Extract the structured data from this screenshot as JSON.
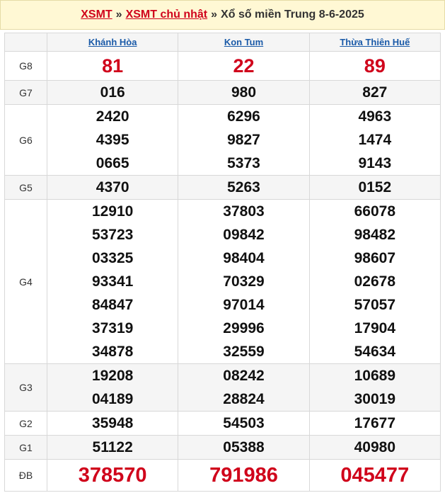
{
  "header": {
    "crumb1": "XSMT",
    "sep1": "»",
    "crumb2": "XSMT chủ nhật",
    "sep2": "»",
    "title": "Xổ số miền Trung 8-6-2025"
  },
  "columns": [
    "Khánh Hòa",
    "Kon Tum",
    "Thừa Thiên Huế"
  ],
  "prizes": [
    {
      "name": "G8",
      "values": [
        [
          "81"
        ],
        [
          "22"
        ],
        [
          "89"
        ]
      ]
    },
    {
      "name": "G7",
      "values": [
        [
          "016"
        ],
        [
          "980"
        ],
        [
          "827"
        ]
      ]
    },
    {
      "name": "G6",
      "values": [
        [
          "2420",
          "4395",
          "0665"
        ],
        [
          "6296",
          "9827",
          "5373"
        ],
        [
          "4963",
          "1474",
          "9143"
        ]
      ]
    },
    {
      "name": "G5",
      "values": [
        [
          "4370"
        ],
        [
          "5263"
        ],
        [
          "0152"
        ]
      ]
    },
    {
      "name": "G4",
      "values": [
        [
          "12910",
          "53723",
          "03325",
          "93341",
          "84847",
          "37319",
          "34878"
        ],
        [
          "37803",
          "09842",
          "98404",
          "70329",
          "97014",
          "29996",
          "32559"
        ],
        [
          "66078",
          "98482",
          "98607",
          "02678",
          "57057",
          "17904",
          "54634"
        ]
      ]
    },
    {
      "name": "G3",
      "values": [
        [
          "19208",
          "04189"
        ],
        [
          "08242",
          "28824"
        ],
        [
          "10689",
          "30019"
        ]
      ]
    },
    {
      "name": "G2",
      "values": [
        [
          "35948"
        ],
        [
          "54503"
        ],
        [
          "17677"
        ]
      ]
    },
    {
      "name": "G1",
      "values": [
        [
          "51122"
        ],
        [
          "05388"
        ],
        [
          "40980"
        ]
      ]
    },
    {
      "name": "ĐB",
      "values": [
        [
          "378570"
        ],
        [
          "791986"
        ],
        [
          "045477"
        ]
      ]
    }
  ],
  "colors": {
    "accent_red": "#d0021b",
    "link_blue": "#1a5aa8",
    "header_bg": "#fff8d4"
  }
}
